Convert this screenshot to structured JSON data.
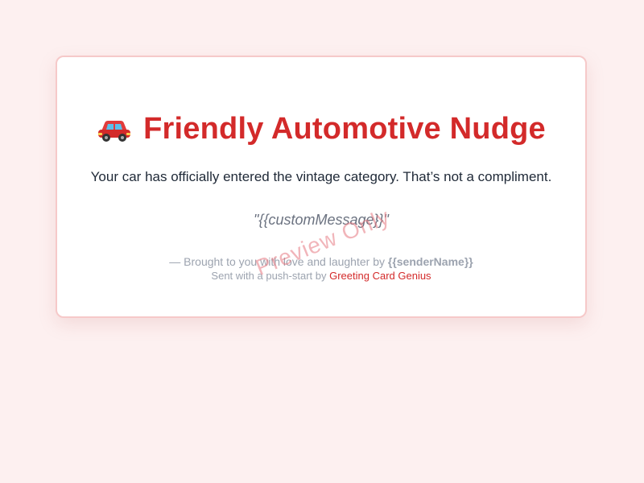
{
  "card": {
    "title": "Friendly Automotive Nudge",
    "icon": "car-icon",
    "body": "Your car has officially entered the vintage category. That’s not a compliment.",
    "custom_message": "\"{{customMessage}}\"",
    "signoff_prefix": "— Brought to you with love and laughter by ",
    "sender_name": "{{senderName}}",
    "credit_prefix": "Sent with a push-start by ",
    "credit_link": "Greeting Card Genius",
    "watermark": "Preview Only"
  },
  "colors": {
    "background": "#fdf0f0",
    "accent": "#d32a2a",
    "card_border": "#f6c9c9",
    "muted_text": "#9ca3af"
  }
}
